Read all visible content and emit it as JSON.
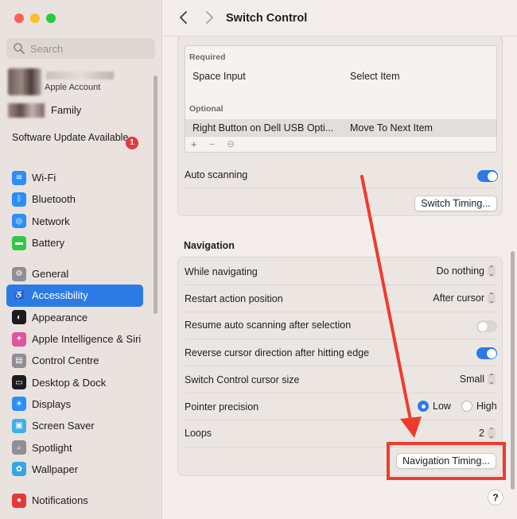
{
  "sidebar": {
    "search": {
      "placeholder": "Search"
    },
    "account": {
      "subtitle": "Apple Account"
    },
    "family": {
      "label": "Family"
    },
    "software_update": {
      "label": "Software Update Available",
      "badge": "1"
    },
    "items_group1": [
      {
        "label": "Wi-Fi",
        "icon": "wifi-icon",
        "color": "#2b8ff7"
      },
      {
        "label": "Bluetooth",
        "icon": "bluetooth-icon",
        "color": "#2b8ff7"
      },
      {
        "label": "Network",
        "icon": "globe-icon",
        "color": "#2b8ff7"
      },
      {
        "label": "Battery",
        "icon": "battery-icon",
        "color": "#33c748"
      }
    ],
    "items_group2": [
      {
        "label": "General",
        "icon": "gear-icon",
        "color": "#8e8e93"
      },
      {
        "label": "Accessibility",
        "icon": "accessibility-icon",
        "color": "#2c7be5",
        "active": true
      },
      {
        "label": "Appearance",
        "icon": "appearance-icon",
        "color": "#1c1c1e"
      },
      {
        "label": "Apple Intelligence & Siri",
        "icon": "siri-icon",
        "color": "#e0559b"
      },
      {
        "label": "Control Centre",
        "icon": "control-centre-icon",
        "color": "#8e8e93"
      },
      {
        "label": "Desktop & Dock",
        "icon": "dock-icon",
        "color": "#1c1c1e"
      },
      {
        "label": "Displays",
        "icon": "displays-icon",
        "color": "#2b8ff7"
      },
      {
        "label": "Screen Saver",
        "icon": "screen-saver-icon",
        "color": "#3fb0e8"
      },
      {
        "label": "Spotlight",
        "icon": "spotlight-icon",
        "color": "#8e8e93"
      },
      {
        "label": "Wallpaper",
        "icon": "wallpaper-icon",
        "color": "#35a6e8"
      }
    ],
    "items_group3": [
      {
        "label": "Notifications",
        "icon": "notifications-icon",
        "color": "#e5383b"
      }
    ]
  },
  "header": {
    "title": "Switch Control"
  },
  "switches": {
    "required_label": "Required",
    "required_rows": [
      {
        "switch": "Space Input",
        "action": "Select Item"
      }
    ],
    "optional_label": "Optional",
    "optional_rows": [
      {
        "switch": "Right Button on Dell USB Opti...",
        "action": "Move To Next Item"
      }
    ],
    "tools": {
      "add": "+",
      "remove": "−",
      "more": "⊖"
    },
    "auto_scanning_label": "Auto scanning",
    "auto_scanning_on": true,
    "switch_timing_button": "Switch Timing..."
  },
  "navigation": {
    "section_title": "Navigation",
    "while_navigating": {
      "label": "While navigating",
      "value": "Do nothing"
    },
    "restart_action": {
      "label": "Restart action position",
      "value": "After cursor"
    },
    "resume_scanning": {
      "label": "Resume auto scanning after selection",
      "on": false
    },
    "reverse_cursor": {
      "label": "Reverse cursor direction after hitting edge",
      "on": true
    },
    "cursor_size": {
      "label": "Switch Control cursor size",
      "value": "Small"
    },
    "pointer_precision": {
      "label": "Pointer precision",
      "options": [
        "Low",
        "High"
      ],
      "selected": "Low"
    },
    "loops": {
      "label": "Loops",
      "value": "2"
    },
    "navigation_timing_button": "Navigation Timing..."
  },
  "help": "?",
  "colors": {
    "accent": "#2c7be5",
    "annotation": "#ef3b2e"
  }
}
